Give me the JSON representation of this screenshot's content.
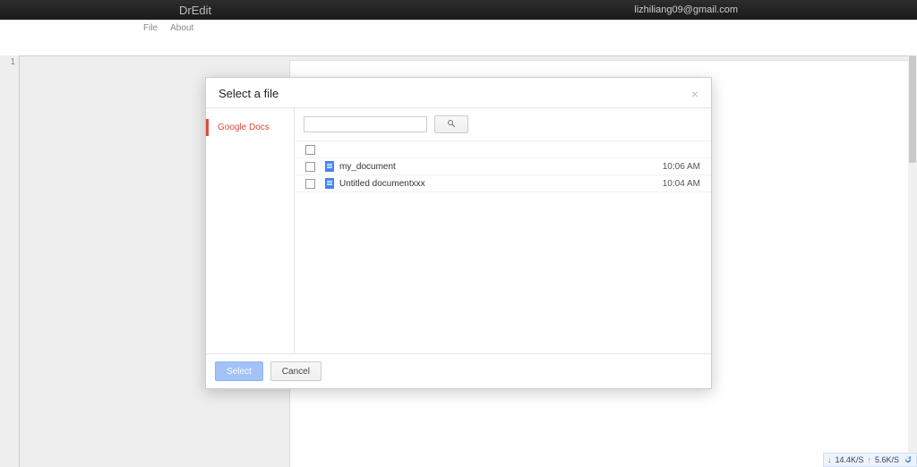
{
  "topbar": {
    "brand": "DrEdit",
    "user_email": "lizhiliang09@gmail.com"
  },
  "menubar": {
    "items": [
      "File",
      "About"
    ]
  },
  "editor": {
    "line_number": "1"
  },
  "modal": {
    "title": "Select a file",
    "sidebar": {
      "items": [
        {
          "label": "Google Docs"
        }
      ]
    },
    "search": {
      "value": "",
      "placeholder": ""
    },
    "files": [
      {
        "name": "my_document",
        "time": "10:06 AM"
      },
      {
        "name": "Untitled documentxxx",
        "time": "10:04 AM"
      }
    ],
    "buttons": {
      "select": "Select",
      "cancel": "Cancel"
    }
  },
  "net": {
    "down": "14.4K/S",
    "up": "5.6K/S"
  }
}
